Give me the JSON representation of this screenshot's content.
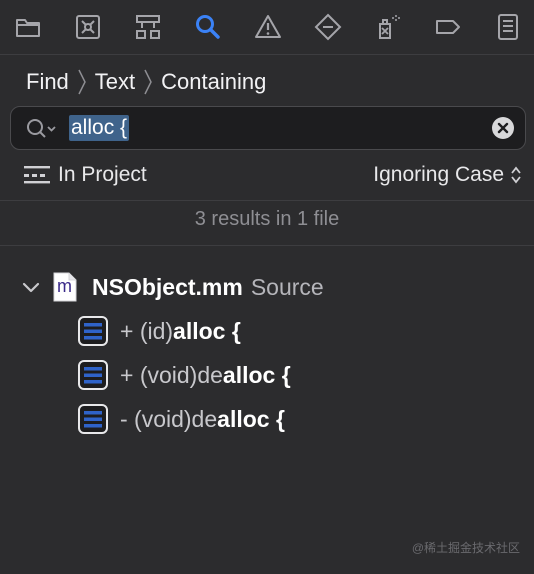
{
  "toolbar": {
    "icons": [
      "folder-icon",
      "source-control-icon",
      "hierarchy-icon",
      "search-icon",
      "warning-icon",
      "test-diamond-icon",
      "debug-spray-icon",
      "breakpoint-tag-icon",
      "report-list-icon"
    ],
    "active_icon": "search-icon",
    "accent_color": "#3b82f6"
  },
  "breadcrumb": {
    "items": [
      "Find",
      "Text",
      "Containing"
    ]
  },
  "search": {
    "value": "alloc {"
  },
  "scope": {
    "label": "In Project"
  },
  "options": {
    "case_label": "Ignoring Case"
  },
  "results": {
    "summary": "3 results in 1 file",
    "file": {
      "icon_letter": "m",
      "name": "NSObject.mm",
      "kind": "Source"
    },
    "matches": [
      {
        "prefix": "+ (id)",
        "match": "alloc {"
      },
      {
        "prefix": "+ (void)de",
        "match": "alloc {"
      },
      {
        "prefix": "- (void)de",
        "match": "alloc {"
      }
    ]
  },
  "watermark": "@稀土掘金技术社区"
}
